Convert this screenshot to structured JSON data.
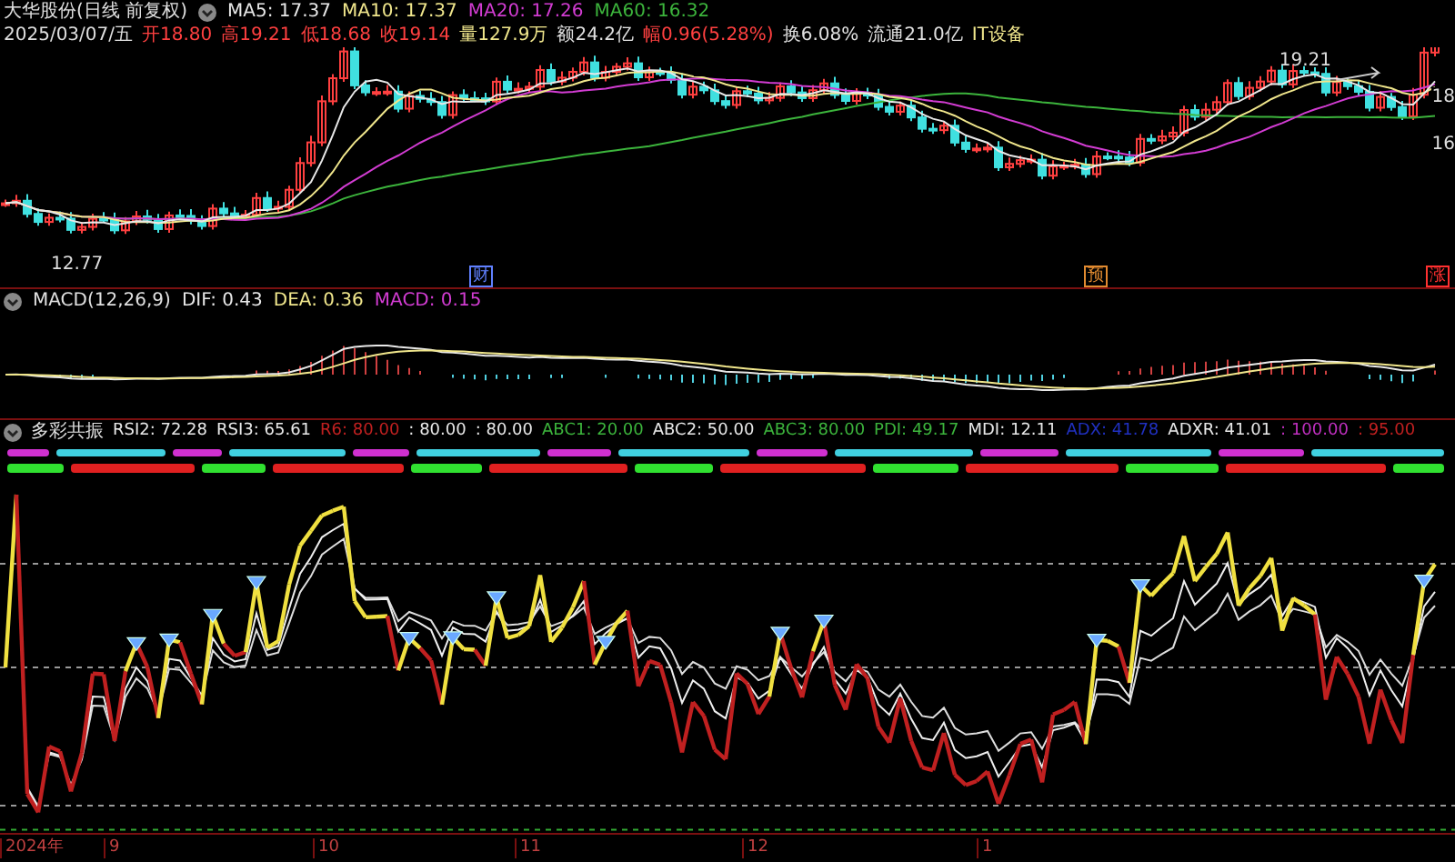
{
  "price_panel": {
    "title": "大华股份(日线 前复权)",
    "moving_averages": [
      {
        "label": "MA5: 17.37",
        "color": "#e8e8e8"
      },
      {
        "label": "MA10: 17.37",
        "color": "#f0e68c"
      },
      {
        "label": "MA20: 17.26",
        "color": "#d23cd2"
      },
      {
        "label": "MA60: 16.32",
        "color": "#3cb43c"
      }
    ],
    "date": "2025/03/07/五",
    "quotes": [
      {
        "label": "开18.80",
        "color": "#ff4040"
      },
      {
        "label": "高19.21",
        "color": "#ff4040"
      },
      {
        "label": "低18.68",
        "color": "#ff4040"
      },
      {
        "label": "收19.14",
        "color": "#ff4040"
      },
      {
        "label": "量127.9万",
        "color": "#f0e68c"
      },
      {
        "label": "额24.2亿",
        "color": "#e0e0e0"
      },
      {
        "label": "幅0.96(5.28%)",
        "color": "#ff4040"
      },
      {
        "label": "换6.08%",
        "color": "#e0e0e0"
      },
      {
        "label": "流通21.0亿",
        "color": "#e0e0e0"
      },
      {
        "label": "IT设备",
        "color": "#f0e68c"
      }
    ],
    "high_label": "19.21",
    "low_label": "12.77",
    "axis_labels": [
      "18",
      "16"
    ],
    "event_markers": [
      {
        "label": "财",
        "color": "#6080ff"
      },
      {
        "label": "预",
        "color": "#e08a30"
      },
      {
        "label": "涨",
        "color": "#ff3030"
      }
    ]
  },
  "macd_panel": {
    "title": "MACD(12,26,9)",
    "values": [
      {
        "label": "DIF: 0.43",
        "color": "#e8e8e8"
      },
      {
        "label": "DEA: 0.36",
        "color": "#f0e68c"
      },
      {
        "label": "MACD: 0.15",
        "color": "#d23cd2"
      }
    ]
  },
  "indicator_panel": {
    "title": "多彩共振",
    "values": [
      {
        "label": "RSI2: 72.28",
        "color": "#e8e8e8"
      },
      {
        "label": "RSI3: 65.61",
        "color": "#e8e8e8"
      },
      {
        "label": "R6: 80.00",
        "color": "#c02020"
      },
      {
        "label": ": 80.00",
        "color": "#e8e8e8"
      },
      {
        "label": ": 80.00",
        "color": "#e8e8e8"
      },
      {
        "label": "ABC1: 20.00",
        "color": "#3cb43c"
      },
      {
        "label": "ABC2: 50.00",
        "color": "#e8e8e8"
      },
      {
        "label": "ABC3: 80.00",
        "color": "#3cb43c"
      },
      {
        "label": "PDI: 49.17",
        "color": "#3cb43c"
      },
      {
        "label": "MDI: 12.11",
        "color": "#e8e8e8"
      },
      {
        "label": "ADX: 41.78",
        "color": "#2030c0"
      },
      {
        "label": "ADXR: 41.01",
        "color": "#e8e8e8"
      },
      {
        "label": ": 100.00",
        "color": "#c030c0"
      },
      {
        "label": ": 95.00",
        "color": "#c02020"
      }
    ]
  },
  "date_axis": [
    "2024年",
    "9",
    "10",
    "11",
    "12",
    "1"
  ]
}
